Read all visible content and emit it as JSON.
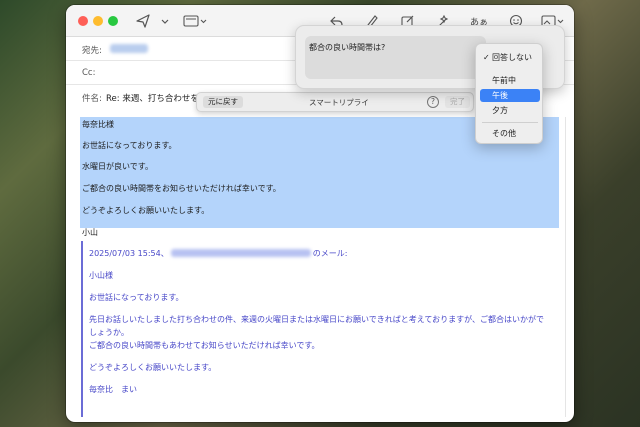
{
  "header": {
    "to_label": "宛先:",
    "cc_label": "Cc:",
    "subject_label": "件名:",
    "subject": "Re: 来週、打ち合わせをお願いいたします"
  },
  "toolbar": {
    "icons": [
      "send-icon",
      "chevron-down-icon",
      "header-fields-icon",
      "reply-icon",
      "markup-icon",
      "compose-icon",
      "writing-tools-icon",
      "format-text-icon",
      "emoji-icon",
      "photo-icon"
    ],
    "format_text": "あぁ"
  },
  "body": {
    "lines": [
      "毎奈比様",
      "お世話になっております。",
      "水曜日が良いです。",
      "ご都合の良い時間帯をお知らせいただければ幸いです。",
      "どうぞよろしくお願いいたします。"
    ],
    "signature": "小山"
  },
  "quote": {
    "date": "2025/07/03 15:54、",
    "suffix": "のメール:",
    "lines": [
      "小山様",
      "お世話になっております。",
      "先日お話しいたしました打ち合わせの件、来週の火曜日または水曜日にお願いできればと考えておりますが、ご都合はいかがで",
      "しょうか。",
      "ご都合の良い時間帯もあわせてお知らせいただければ幸いです。",
      "どうぞよろしくお願いいたします。",
      "毎奈比　まい"
    ]
  },
  "smart_reply": {
    "undo_label": "元に戻す",
    "title": "スマートリプライ",
    "help_label": "?",
    "done_label": "完了"
  },
  "question": {
    "text": "都合の良い時間帯は?"
  },
  "menu": {
    "items": [
      {
        "label": "回答しない",
        "checked": true
      },
      {
        "label": "午前中"
      },
      {
        "label": "午後",
        "highlighted": true
      },
      {
        "label": "夕方"
      },
      {
        "label": "その他"
      }
    ]
  },
  "colors": {
    "selection": "#b4d4fb",
    "quote_text": "#4747c8",
    "menu_highlight": "#3b82f6"
  }
}
